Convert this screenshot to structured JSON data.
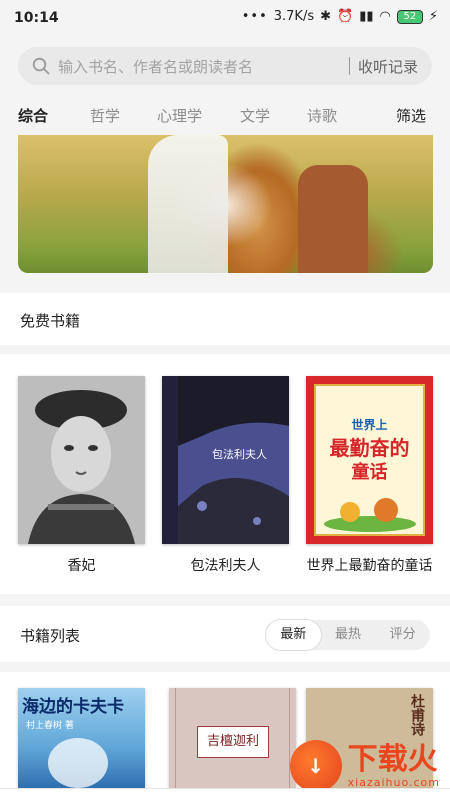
{
  "status": {
    "time": "10:14",
    "network": "3.7K/s",
    "battery": "52"
  },
  "search": {
    "placeholder": "输入书名、作者名或朗读者名",
    "history_label": "收听记录"
  },
  "tabs": [
    "综合",
    "哲学",
    "心理学",
    "文学",
    "诗歌"
  ],
  "filter_label": "筛选",
  "free_books": {
    "title": "免费书籍",
    "books": [
      {
        "name": "香妃"
      },
      {
        "name": "包法利夫人",
        "cover_text": "包法利夫人"
      },
      {
        "name": "世界上最勤奋的童话",
        "cover_text_1": "世界上",
        "cover_text_2": "最勤奋的",
        "cover_text_3": "童话"
      }
    ]
  },
  "book_list": {
    "title": "书籍列表",
    "sort_options": [
      "最新",
      "最热",
      "评分"
    ],
    "books": [
      {
        "cover_text": "海边的卡夫卡",
        "author_text": "村上春树 著"
      },
      {
        "cover_text": "吉檀迦利"
      },
      {
        "cover_text": "杜甫诗"
      }
    ]
  },
  "watermark": {
    "brand": "下载火",
    "url": "xiazaihuo.com"
  }
}
